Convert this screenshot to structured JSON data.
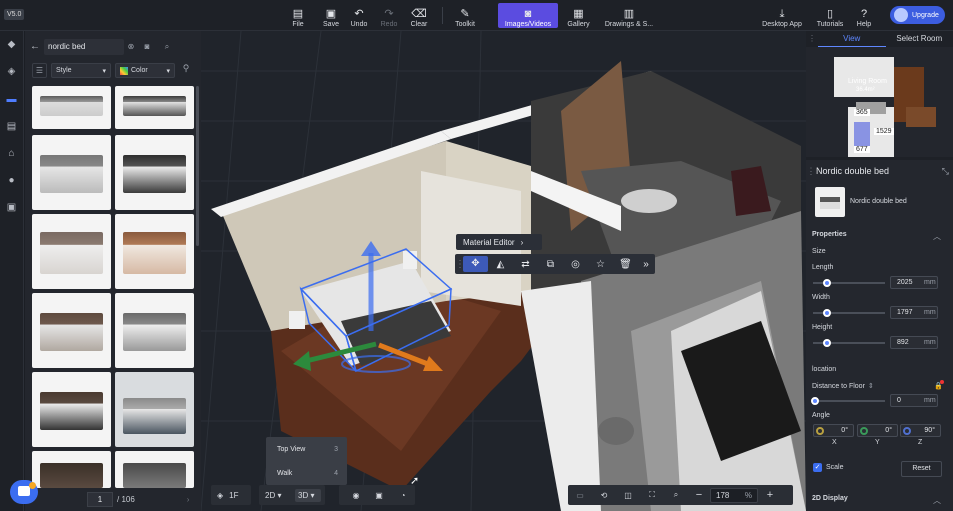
{
  "app": {
    "version": "V5.0"
  },
  "toolbar": {
    "file": "File",
    "save": "Save",
    "undo": "Undo",
    "redo": "Redo",
    "clear": "Clear",
    "toolkit": "Toolkit",
    "images_videos": "Images/Videos",
    "gallery": "Gallery",
    "drawings": "Drawings & S...",
    "desktop_app": "Desktop App",
    "tutorials": "Tutorials",
    "help": "Help",
    "upgrade": "Upgrade"
  },
  "catalog": {
    "search_value": "nordic bed",
    "filter_style": "Style",
    "filter_color": "Color",
    "page_current": "1",
    "page_total": "/ 106"
  },
  "context_menu": {
    "material_editor": "Material Editor"
  },
  "view_menu": {
    "items": [
      {
        "label": "Top View",
        "shortcut": "3"
      },
      {
        "label": "Walk",
        "shortcut": "4"
      }
    ]
  },
  "bottom_bar": {
    "floor": "1F",
    "mode_2d": "2D",
    "mode_3d": "3D",
    "zoom": "178",
    "zoom_unit": "%"
  },
  "right_panel": {
    "tabs": [
      "View",
      "Select Room"
    ],
    "minimap": {
      "room_label": "Living Room",
      "room_area": "36.4m²",
      "dims": [
        "365",
        "1529",
        "677"
      ]
    },
    "object_title": "Nordic double bed",
    "object_name": "Nordic double bed",
    "properties_title": "Properties",
    "size_label": "Size",
    "length_label": "Length",
    "length_value": "2025",
    "length_unit": "mm",
    "width_label": "Width",
    "width_value": "1797",
    "width_unit": "mm",
    "height_label": "Height",
    "height_value": "892",
    "height_unit": "mm",
    "location_label": "location",
    "distance_label": "Distance to Floor",
    "distance_value": "0",
    "distance_unit": "mm",
    "angle_label": "Angle",
    "angle_x": "0°",
    "angle_y": "0°",
    "angle_z": "90°",
    "axis_x": "X",
    "axis_y": "Y",
    "axis_z": "Z",
    "scale_label": "Scale",
    "reset_label": "Reset",
    "display_2d_label": "2D Display"
  }
}
